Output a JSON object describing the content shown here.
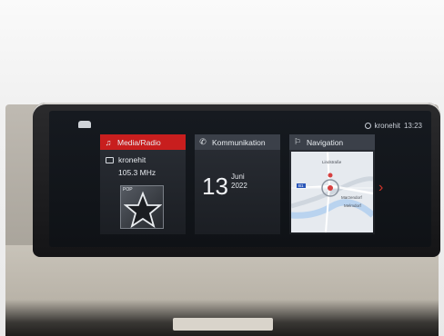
{
  "status_bar": {
    "radio_station": "kronehit",
    "time": "13:23"
  },
  "tiles": {
    "media": {
      "title": "Media/Radio",
      "station": "kronehit",
      "frequency": "105.3 MHz",
      "cover_label": "POP"
    },
    "communication": {
      "title": "Kommunikation",
      "day": "13",
      "month": "Juni",
      "year": "2022"
    },
    "navigation": {
      "title": "Navigation",
      "map_labels": {
        "street": "Lindstraße",
        "route": "B1",
        "town_1": "Marzendorf",
        "town_2": "Melmdorf"
      }
    }
  },
  "icons": {
    "media": "music-note-icon",
    "communication": "phone-icon",
    "navigation": "navigation-icon",
    "next": "chevron-right-icon"
  },
  "colors": {
    "accent": "#c81e1e",
    "tile_header": "#3b4049",
    "route": "#2a56b8"
  }
}
